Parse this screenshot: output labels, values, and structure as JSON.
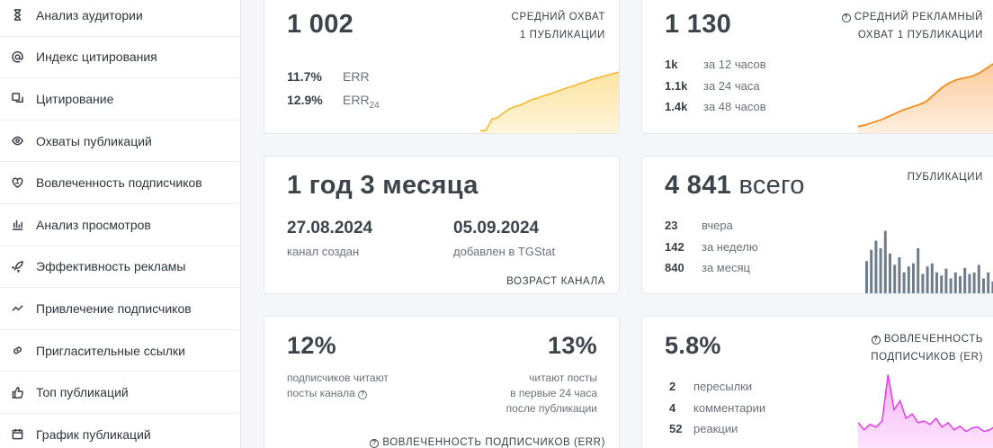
{
  "sidebar": {
    "items": [
      {
        "label": "Анализ аудитории",
        "icon": "hourglass-icon"
      },
      {
        "label": "Индекс цитирования",
        "icon": "at-icon"
      },
      {
        "label": "Цитирование",
        "icon": "quote-icon"
      },
      {
        "label": "Охваты публикаций",
        "icon": "eye-icon"
      },
      {
        "label": "Вовлеченность подписчиков",
        "icon": "heart-hand-icon"
      },
      {
        "label": "Анализ просмотров",
        "icon": "bar-chart-icon"
      },
      {
        "label": "Эффективность рекламы",
        "icon": "rocket-icon"
      },
      {
        "label": "Привлечение подписчиков",
        "icon": "trend-icon"
      },
      {
        "label": "Пригласительные ссылки",
        "icon": "link-icon"
      },
      {
        "label": "Топ публикаций",
        "icon": "thumbs-up-icon"
      },
      {
        "label": "График публикаций",
        "icon": "calendar-icon"
      }
    ]
  },
  "reach": {
    "value": "1 002",
    "caption_line1": "СРЕДНИЙ ОХВАТ",
    "caption_line2": "1 ПУБЛИКАЦИИ",
    "err_value": "11.7%",
    "err_label": "ERR",
    "err24_value": "12.9%",
    "err24_label": "ERR",
    "err24_sub": "24",
    "color": "#f5b731"
  },
  "ad_reach": {
    "value": "1 130",
    "caption_line1": "СРЕДНИЙ РЕКЛАМНЫЙ",
    "caption_line2": "ОХВАТ 1 ПУБЛИКАЦИИ",
    "rows": [
      {
        "value": "1k",
        "label": "за 12 часов"
      },
      {
        "value": "1.1k",
        "label": "за 24 часа"
      },
      {
        "value": "1.4k",
        "label": "за 48 часов"
      }
    ],
    "color": "#f28c1e"
  },
  "age": {
    "value": "1 год 3 месяца",
    "created_date": "27.08.2024",
    "created_label": "канал создан",
    "added_date": "05.09.2024",
    "added_label": "добавлен в TGStat",
    "caption": "ВОЗРАСТ КАНАЛА"
  },
  "posts": {
    "value": "4 841",
    "value_suffix": "всего",
    "caption": "ПУБЛИКАЦИИ",
    "rows": [
      {
        "value": "23",
        "label": "вчера"
      },
      {
        "value": "142",
        "label": "за неделю"
      },
      {
        "value": "840",
        "label": "за месяц"
      }
    ],
    "color": "#6f7d8c"
  },
  "err": {
    "left_value": "12%",
    "left_line1": "подписчиков читают",
    "left_line2": "посты канала",
    "right_value": "13%",
    "right_line1": "читают посты",
    "right_line2": "в первые 24 часа",
    "right_line3": "после публикации",
    "caption": "ВОВЛЕЧЕННОСТЬ ПОДПИСЧИКОВ (ERR)"
  },
  "er": {
    "value": "5.8%",
    "caption_line1": "ВОВЛЕЧЕННОСТЬ",
    "caption_line2": "ПОДПИСЧИКОВ (ER)",
    "rows": [
      {
        "value": "2",
        "label": "пересылки"
      },
      {
        "value": "4",
        "label": "комментарии"
      },
      {
        "value": "52",
        "label": "реакции"
      }
    ],
    "color": "#e23be6"
  },
  "sparklines": {
    "reach": [
      0.05,
      0.06,
      0.2,
      0.22,
      0.28,
      0.33,
      0.36,
      0.38,
      0.42,
      0.45,
      0.47,
      0.5,
      0.52,
      0.55,
      0.57,
      0.6,
      0.62,
      0.65,
      0.67,
      0.7,
      0.72,
      0.74,
      0.76,
      0.78,
      0.8
    ],
    "ad_reach": [
      0.1,
      0.12,
      0.15,
      0.18,
      0.22,
      0.26,
      0.3,
      0.33,
      0.36,
      0.4,
      0.48,
      0.56,
      0.62,
      0.66,
      0.68,
      0.7,
      0.74,
      0.8,
      0.86,
      0.9
    ],
    "posts": [
      0.45,
      0.6,
      0.72,
      0.62,
      0.85,
      0.55,
      0.4,
      0.5,
      0.3,
      0.38,
      0.42,
      0.62,
      0.28,
      0.38,
      0.42,
      0.3,
      0.26,
      0.35,
      0.22,
      0.3,
      0.25,
      0.36,
      0.28,
      0.3,
      0.4,
      0.22,
      0.3,
      0.18,
      0.26
    ],
    "er": [
      0.3,
      0.22,
      0.28,
      0.25,
      0.32,
      0.85,
      0.45,
      0.55,
      0.35,
      0.4,
      0.3,
      0.32,
      0.28,
      0.35,
      0.25,
      0.3,
      0.22,
      0.26,
      0.2,
      0.24,
      0.25,
      0.2,
      0.22,
      0.27,
      0.24
    ]
  }
}
